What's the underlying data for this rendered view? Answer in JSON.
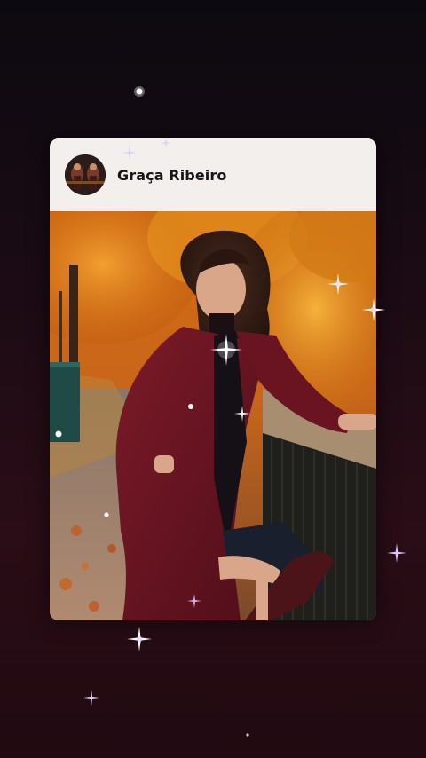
{
  "post": {
    "author_name": "Graça Ribeiro",
    "avatar_icon": "profile-avatar-icon",
    "photo_alt": "photo"
  },
  "colors": {
    "background": "#1a0b14",
    "card_header": "#f3efec",
    "author_text": "#161616",
    "coat": "#6e1423",
    "foliage": "#e08a1e"
  },
  "decorations": {
    "sparkle_icon": "sparkle-icon"
  }
}
